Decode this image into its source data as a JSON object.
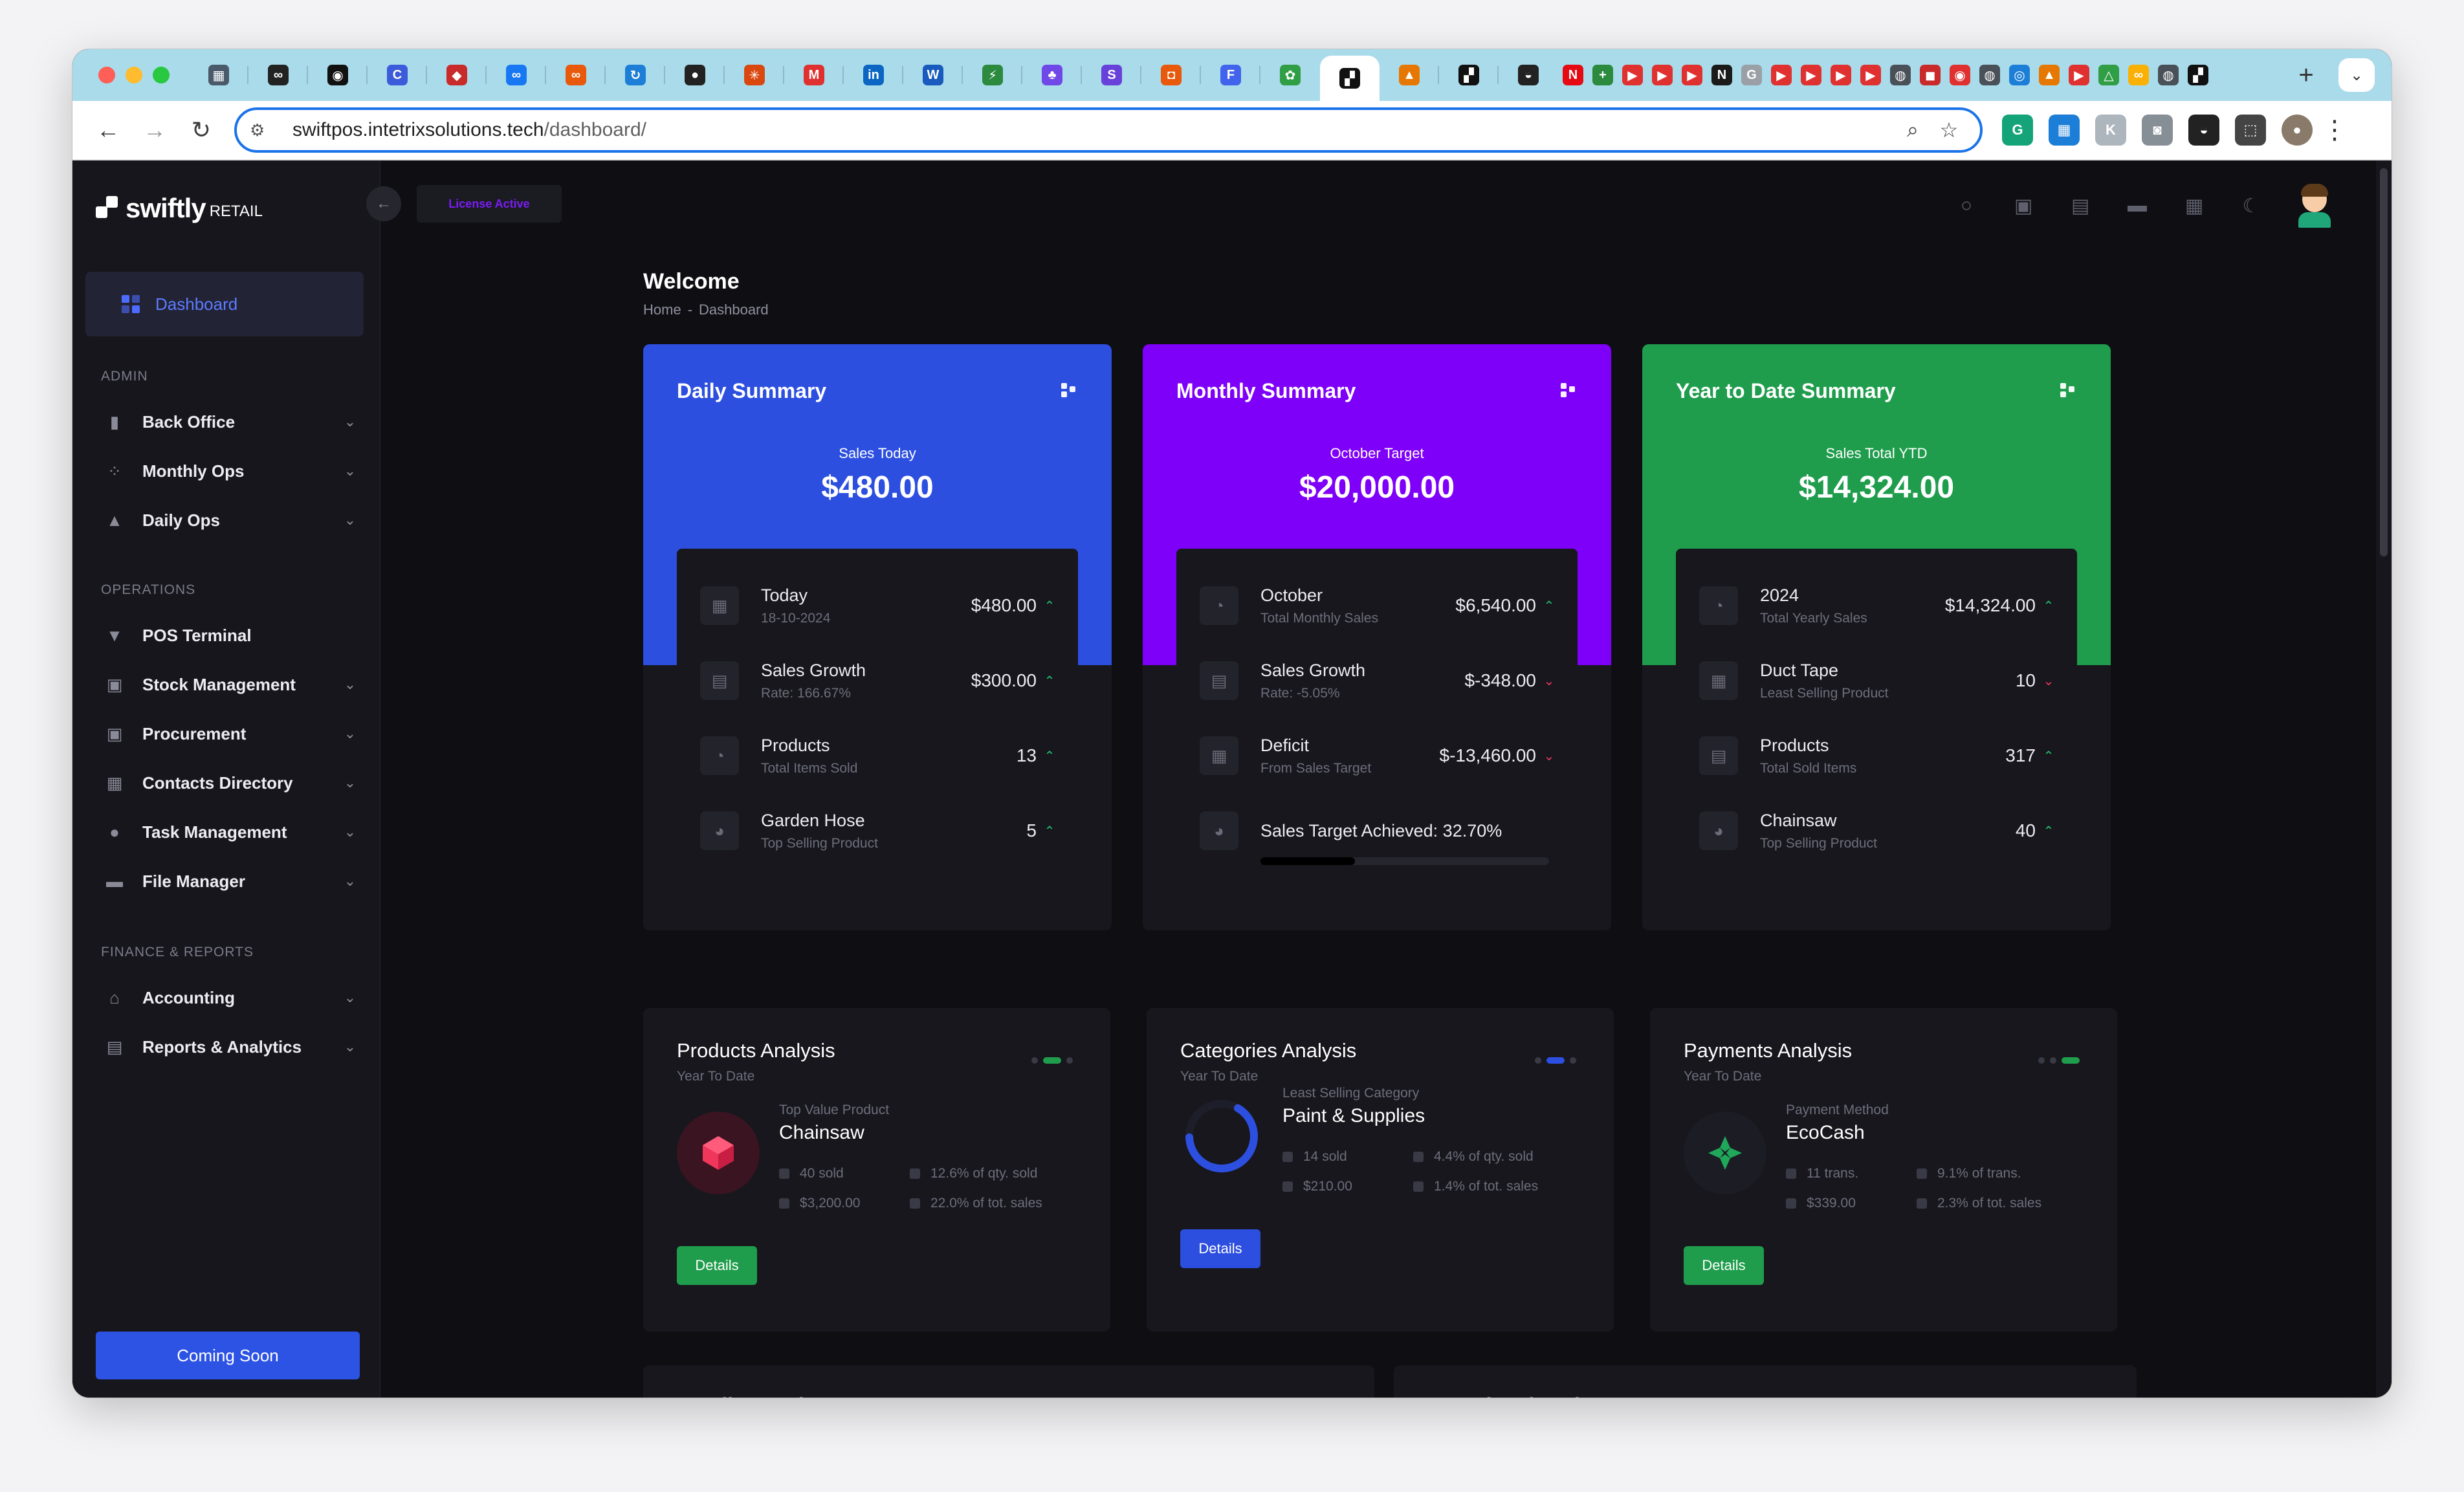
{
  "browser": {
    "url_host": "swiftpos.intetrixsolutions.tech",
    "url_path": "/dashboard/",
    "new_tab": "+",
    "tabs": [
      {
        "icon": "dashboard-favicon",
        "color": "#4a5a6a",
        "glyph": "▦"
      },
      {
        "icon": "infinity-favicon",
        "color": "#222222",
        "glyph": "∞"
      },
      {
        "icon": "discord-favicon",
        "color": "#111111",
        "glyph": "◉"
      },
      {
        "icon": "cursor-favicon",
        "color": "#3b5bdb",
        "glyph": "C"
      },
      {
        "icon": "cube-favicon",
        "color": "#c92a2a",
        "glyph": "◆"
      },
      {
        "icon": "meta-favicon",
        "color": "#1877f2",
        "glyph": "∞"
      },
      {
        "icon": "link-favicon",
        "color": "#e8590c",
        "glyph": "∞"
      },
      {
        "icon": "refresh-favicon",
        "color": "#1c7ed6",
        "glyph": "↻"
      },
      {
        "icon": "github-favicon",
        "color": "#222222",
        "glyph": "●"
      },
      {
        "icon": "claude-favicon",
        "color": "#d9480f",
        "glyph": "✳"
      },
      {
        "icon": "gmail-favicon",
        "color": "#e03131",
        "glyph": "M"
      },
      {
        "icon": "linkedin-favicon",
        "color": "#0a66c2",
        "glyph": "in"
      },
      {
        "icon": "word-favicon",
        "color": "#185abd",
        "glyph": "W"
      },
      {
        "icon": "bolt-favicon",
        "color": "#2b8a3e",
        "glyph": "⚡"
      },
      {
        "icon": "android-favicon",
        "color": "#7048e8",
        "glyph": "♣"
      },
      {
        "icon": "stripe-favicon",
        "color": "#6741d9",
        "glyph": "S"
      },
      {
        "icon": "app-favicon",
        "color": "#e8590c",
        "glyph": "◘"
      },
      {
        "icon": "forms-favicon",
        "color": "#4263eb",
        "glyph": "F"
      },
      {
        "icon": "frog-favicon",
        "color": "#2f9e44",
        "glyph": "✿"
      },
      {
        "icon": "swiftly-favicon",
        "color": "#111111",
        "glyph": "▞"
      },
      {
        "icon": "chart-favicon",
        "color": "#e67700",
        "glyph": "▲"
      },
      {
        "icon": "swiftly2-favicon",
        "color": "#111111",
        "glyph": "▞"
      },
      {
        "icon": "disc-favicon",
        "color": "#222222",
        "glyph": "◒"
      },
      {
        "icon": "netflix-favicon",
        "color": "#e50914",
        "glyph": "N"
      },
      {
        "icon": "sheets-favicon",
        "color": "#2b8a3e",
        "glyph": "+"
      },
      {
        "icon": "youtube-favicon",
        "color": "#e03131",
        "glyph": "▶"
      },
      {
        "icon": "youtube-favicon",
        "color": "#e03131",
        "glyph": "▶"
      },
      {
        "icon": "youtube-favicon",
        "color": "#e03131",
        "glyph": "▶"
      },
      {
        "icon": "notion-favicon",
        "color": "#1a1a1a",
        "glyph": "N"
      },
      {
        "icon": "google-favicon",
        "color": "#9aa0a6",
        "glyph": "G"
      },
      {
        "icon": "youtube-favicon",
        "color": "#e03131",
        "glyph": "▶"
      },
      {
        "icon": "youtube-favicon",
        "color": "#e03131",
        "glyph": "▶"
      },
      {
        "icon": "youtube-favicon",
        "color": "#e03131",
        "glyph": "▶"
      },
      {
        "icon": "youtube-favicon",
        "color": "#e03131",
        "glyph": "▶"
      },
      {
        "icon": "globe-favicon",
        "color": "#495057",
        "glyph": "◍"
      },
      {
        "icon": "red-favicon",
        "color": "#c92a2a",
        "glyph": "◼"
      },
      {
        "icon": "record-favicon",
        "color": "#e03131",
        "glyph": "◉"
      },
      {
        "icon": "globe-favicon",
        "color": "#495057",
        "glyph": "◍"
      },
      {
        "icon": "blue-favicon",
        "color": "#1c7ed6",
        "glyph": "◎"
      },
      {
        "icon": "chart-favicon",
        "color": "#e67700",
        "glyph": "▲"
      },
      {
        "icon": "youtube-favicon",
        "color": "#e03131",
        "glyph": "▶"
      },
      {
        "icon": "drive-favicon",
        "color": "#2f9e44",
        "glyph": "△"
      },
      {
        "icon": "infinity-favicon",
        "color": "#fab005",
        "glyph": "∞"
      },
      {
        "icon": "globe-favicon",
        "color": "#495057",
        "glyph": "◍"
      },
      {
        "icon": "swiftly3-favicon",
        "color": "#111111",
        "glyph": "▞"
      }
    ],
    "extensions": [
      {
        "icon": "grammarly-icon",
        "color": "#15a37a",
        "glyph": "G"
      },
      {
        "icon": "trello-icon",
        "color": "#1c7ed6",
        "glyph": "▦"
      },
      {
        "icon": "k-icon",
        "color": "#adb5bd",
        "glyph": "K"
      },
      {
        "icon": "camera-icon",
        "color": "#868e96",
        "glyph": "◙"
      },
      {
        "icon": "disc-icon",
        "color": "#222222",
        "glyph": "◒"
      },
      {
        "icon": "puzzle-icon",
        "color": "#444444",
        "glyph": "⬚"
      },
      {
        "icon": "profile-icon",
        "color": "#8a7a6a",
        "glyph": "●"
      }
    ]
  },
  "sidebar": {
    "logo_text": "swiftly",
    "logo_sub": "RETAIL",
    "dashboard": "Dashboard",
    "sections": [
      {
        "title": "ADMIN",
        "items": [
          {
            "label": "Back Office",
            "icon": "book-icon",
            "glyph": "▮",
            "chevron": true
          },
          {
            "label": "Monthly Ops",
            "icon": "calendar-icon",
            "glyph": "⁘",
            "chevron": true
          },
          {
            "label": "Daily Ops",
            "icon": "flask-icon",
            "glyph": "▲",
            "chevron": true
          }
        ]
      },
      {
        "title": "OPERATIONS",
        "items": [
          {
            "label": "POS Terminal",
            "icon": "basket-icon",
            "glyph": "▼",
            "chevron": false
          },
          {
            "label": "Stock Management",
            "icon": "box-icon",
            "glyph": "▣",
            "chevron": true
          },
          {
            "label": "Procurement",
            "icon": "cart-icon",
            "glyph": "▣",
            "chevron": true
          },
          {
            "label": "Contacts Directory",
            "icon": "grid-icon",
            "glyph": "▦",
            "chevron": true
          },
          {
            "label": "Task Management",
            "icon": "person-icon",
            "glyph": "●",
            "chevron": true
          },
          {
            "label": "File Manager",
            "icon": "toggle-icon",
            "glyph": "▬",
            "chevron": true
          }
        ]
      },
      {
        "title": "FINANCE & REPORTS",
        "items": [
          {
            "label": "Accounting",
            "icon": "bank-icon",
            "glyph": "⌂",
            "chevron": true
          },
          {
            "label": "Reports & Analytics",
            "icon": "report-icon",
            "glyph": "▤",
            "chevron": true
          }
        ]
      }
    ],
    "coming_soon": "Coming Soon"
  },
  "topbar": {
    "license": "License Active"
  },
  "header": {
    "title": "Welcome",
    "crumb_home": "Home",
    "crumb_sep": "-",
    "crumb_current": "Dashboard"
  },
  "summaries": [
    {
      "title": "Daily Summary",
      "color": "#2d4fe0",
      "label": "Sales Today",
      "value": "$480.00",
      "rows": [
        {
          "title": "Today",
          "sub": "18-10-2024",
          "value": "$480.00",
          "trend": "up",
          "icon": "grid-icon"
        },
        {
          "title": "Sales Growth",
          "sub": "Rate: 166.67%",
          "value": "$300.00",
          "trend": "up",
          "icon": "chart-icon"
        },
        {
          "title": "Products",
          "sub": "Total Items Sold",
          "value": "13",
          "trend": "up",
          "icon": "compass-icon"
        },
        {
          "title": "Garden Hose",
          "sub": "Top Selling Product",
          "value": "5",
          "trend": "up",
          "icon": "pie-icon"
        }
      ]
    },
    {
      "title": "Monthly Summary",
      "color": "#7e00f8",
      "label": "October Target",
      "value": "$20,000.00",
      "rows": [
        {
          "title": "October",
          "sub": "Total Monthly Sales",
          "value": "$6,540.00",
          "trend": "up",
          "icon": "compass-icon"
        },
        {
          "title": "Sales Growth",
          "sub": "Rate: -5.05%",
          "value": "$-348.00",
          "trend": "down",
          "icon": "chart-icon"
        },
        {
          "title": "Deficit",
          "sub": "From Sales Target",
          "value": "$-13,460.00",
          "trend": "down",
          "icon": "grid-icon"
        },
        {
          "title": "Sales Target Achieved: 32.70%",
          "sub": "",
          "value": "",
          "trend": "none",
          "icon": "pie-icon",
          "progress": 32.7
        }
      ]
    },
    {
      "title": "Year to Date Summary",
      "color": "#1f9d4c",
      "label": "Sales Total YTD",
      "value": "$14,324.00",
      "rows": [
        {
          "title": "2024",
          "sub": "Total Yearly Sales",
          "value": "$14,324.00",
          "trend": "up",
          "icon": "compass-icon"
        },
        {
          "title": "Duct Tape",
          "sub": "Least Selling Product",
          "value": "10",
          "trend": "down",
          "icon": "grid-icon"
        },
        {
          "title": "Products",
          "sub": "Total Sold Items",
          "value": "317",
          "trend": "up",
          "icon": "chart-icon"
        },
        {
          "title": "Chainsaw",
          "sub": "Top Selling Product",
          "value": "40",
          "trend": "up",
          "icon": "pie-icon"
        }
      ]
    }
  ],
  "analysis": [
    {
      "title": "Products Analysis",
      "sub": "Year To Date",
      "accent": "#1f9d4c",
      "active_dot": 1,
      "label": "Top Value Product",
      "name": "Chainsaw",
      "stats": [
        "40 sold",
        "12.6% of qty. sold",
        "$3,200.00",
        "22.0% of tot. sales"
      ],
      "details": "Details",
      "icon": "cube-icon"
    },
    {
      "title": "Categories Analysis",
      "sub": "Year To Date",
      "accent": "#2d4fe0",
      "active_dot": 1,
      "label": "Least Selling Category",
      "name": "Paint & Supplies",
      "stats": [
        "14 sold",
        "4.4% of qty. sold",
        "$210.00",
        "1.4% of tot. sales"
      ],
      "details": "Details",
      "icon": "donut-icon",
      "progress": 4.4
    },
    {
      "title": "Payments Analysis",
      "sub": "Year To Date",
      "accent": "#1f9d4c",
      "active_dot": 2,
      "label": "Payment Method",
      "name": "EcoCash",
      "stats": [
        "11 trans.",
        "9.1% of trans.",
        "$339.00",
        "2.3% of tot. sales"
      ],
      "details": "Details",
      "icon": "ecocash-icon"
    }
  ],
  "tasks": [
    {
      "title": "Pending Tasks",
      "sub": "Only Showing Last Five Records"
    },
    {
      "title": "Completed Tasks",
      "sub": "Only Showing Last Five Records"
    }
  ]
}
